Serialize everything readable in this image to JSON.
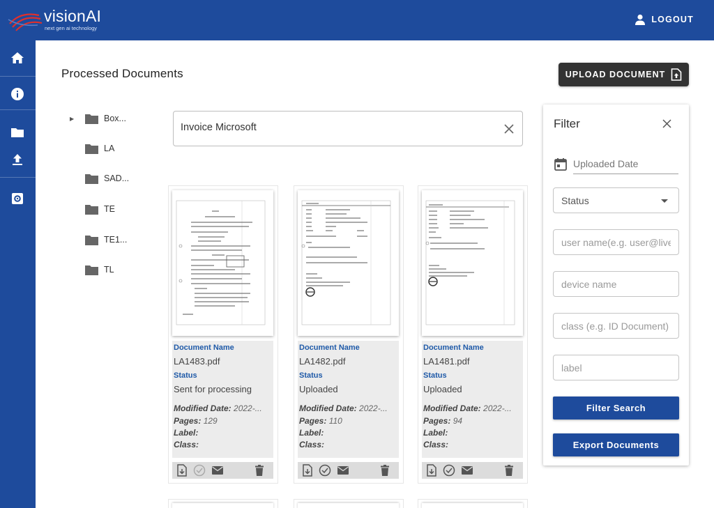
{
  "header": {
    "brand": "visionAI",
    "tagline": "next gen ai technology",
    "logout_label": "LOGOUT",
    "accent_color": "#1e4b9c"
  },
  "leftnav": {
    "items": [
      {
        "icon": "home-icon"
      },
      {
        "icon": "info-icon"
      },
      {
        "icon": "folder-icon"
      },
      {
        "icon": "upload-icon"
      },
      {
        "icon": "settings-icon"
      }
    ]
  },
  "main": {
    "title": "Processed Documents",
    "upload_label": "UPLOAD DOCUMENT"
  },
  "tree": {
    "folders": [
      {
        "label": "Box...",
        "expandable": true
      },
      {
        "label": "LA",
        "expandable": false
      },
      {
        "label": "SAD...",
        "expandable": false
      },
      {
        "label": "TE",
        "expandable": false
      },
      {
        "label": "TE1...",
        "expandable": false
      },
      {
        "label": "TL",
        "expandable": false
      }
    ]
  },
  "search": {
    "value": "Invoice Microsoft"
  },
  "cards": [
    {
      "name_label": "Document Name",
      "name": "LA1483.pdf",
      "status_label": "Status",
      "status": "Sent for processing",
      "modified_label": "Modified Date:",
      "modified": "2022-...",
      "pages_label": "Pages:",
      "pages": "129",
      "label_label": "Label:",
      "class_label": "Class:"
    },
    {
      "name_label": "Document Name",
      "name": "LA1482.pdf",
      "status_label": "Status",
      "status": "Uploaded",
      "modified_label": "Modified Date:",
      "modified": "2022-...",
      "pages_label": "Pages:",
      "pages": "110",
      "label_label": "Label:",
      "class_label": "Class:"
    },
    {
      "name_label": "Document Name",
      "name": "LA1481.pdf",
      "status_label": "Status",
      "status": "Uploaded",
      "modified_label": "Modified Date:",
      "modified": "2022-...",
      "pages_label": "Pages:",
      "pages": "94",
      "label_label": "Label:",
      "class_label": "Class:"
    }
  ],
  "filter": {
    "title": "Filter",
    "date_placeholder": "Uploaded Date",
    "status_placeholder": "Status",
    "username_placeholder": "user name(e.g. user@live",
    "device_placeholder": "device name",
    "class_placeholder": "class (e.g. ID Document)",
    "label_placeholder": "label",
    "search_button": "Filter Search",
    "export_button": "Export Documents"
  }
}
